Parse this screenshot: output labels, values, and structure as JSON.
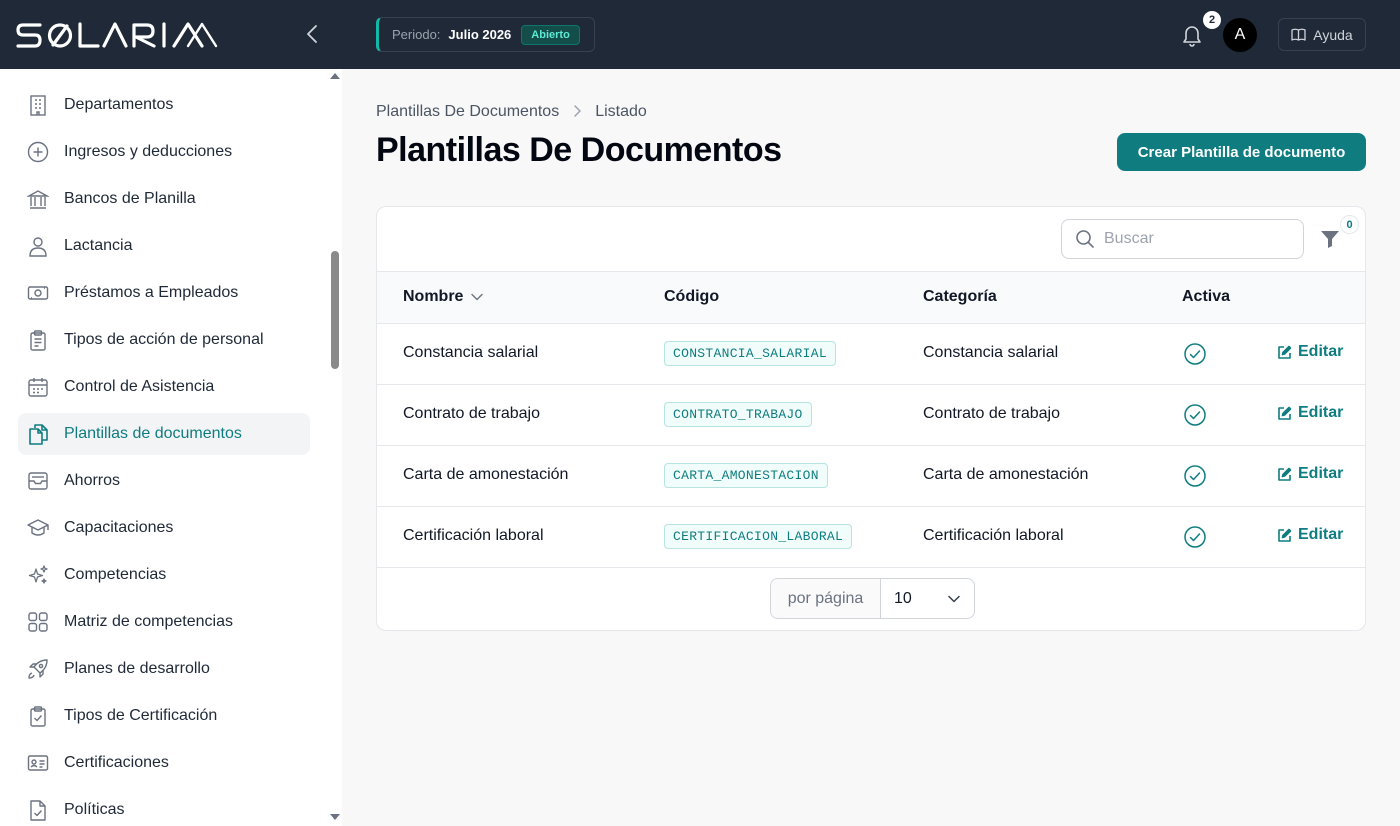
{
  "app": {
    "brand": "SOLARIA",
    "period_label": "Periodo:",
    "period_value": "Julio 2026",
    "period_status": "Abierto",
    "notifications_count": "2",
    "user_initial": "A",
    "help_label": "Ayuda"
  },
  "sidebar": {
    "items": [
      {
        "label": "Departamentos",
        "icon": "building-icon"
      },
      {
        "label": "Ingresos y deducciones",
        "icon": "plus-circle-icon"
      },
      {
        "label": "Bancos de Planilla",
        "icon": "bank-icon"
      },
      {
        "label": "Lactancia",
        "icon": "user-icon"
      },
      {
        "label": "Préstamos a Empleados",
        "icon": "cash-icon"
      },
      {
        "label": "Tipos de acción de personal",
        "icon": "clipboard-icon"
      },
      {
        "label": "Control de Asistencia",
        "icon": "calendar-icon"
      },
      {
        "label": "Plantillas de documentos",
        "icon": "documents-icon",
        "active": true
      },
      {
        "label": "Ahorros",
        "icon": "inbox-icon"
      },
      {
        "label": "Capacitaciones",
        "icon": "graduation-cap-icon"
      },
      {
        "label": "Competencias",
        "icon": "sparkles-icon"
      },
      {
        "label": "Matriz de competencias",
        "icon": "grid-icon"
      },
      {
        "label": "Planes de desarrollo",
        "icon": "rocket-icon"
      },
      {
        "label": "Tipos de Certificación",
        "icon": "clipboard-check-icon"
      },
      {
        "label": "Certificaciones",
        "icon": "id-card-icon"
      },
      {
        "label": "Políticas",
        "icon": "document-check-icon"
      }
    ]
  },
  "breadcrumb": {
    "parent": "Plantillas De Documentos",
    "current": "Listado"
  },
  "page": {
    "title": "Plantillas De Documentos",
    "create_label": "Crear Plantilla de documento"
  },
  "toolbar": {
    "search_placeholder": "Buscar",
    "filter_count": "0"
  },
  "table": {
    "columns": [
      "Nombre",
      "Código",
      "Categoría",
      "Activa"
    ],
    "edit_label": "Editar",
    "rows": [
      {
        "nombre": "Constancia salarial",
        "codigo": "CONSTANCIA_SALARIAL",
        "categoria": "Constancia salarial",
        "activa": true
      },
      {
        "nombre": "Contrato de trabajo",
        "codigo": "CONTRATO_TRABAJO",
        "categoria": "Contrato de trabajo",
        "activa": true
      },
      {
        "nombre": "Carta de amonestación",
        "codigo": "CARTA_AMONESTACION",
        "categoria": "Carta de amonestación",
        "activa": true
      },
      {
        "nombre": "Certificación laboral",
        "codigo": "CERTIFICACION_LABORAL",
        "categoria": "Certificación laboral",
        "activa": true
      }
    ]
  },
  "pagination": {
    "per_page_label": "por página",
    "per_page_value": "10"
  },
  "colors": {
    "accent": "#0f7d80",
    "topbar": "#1f2937"
  }
}
